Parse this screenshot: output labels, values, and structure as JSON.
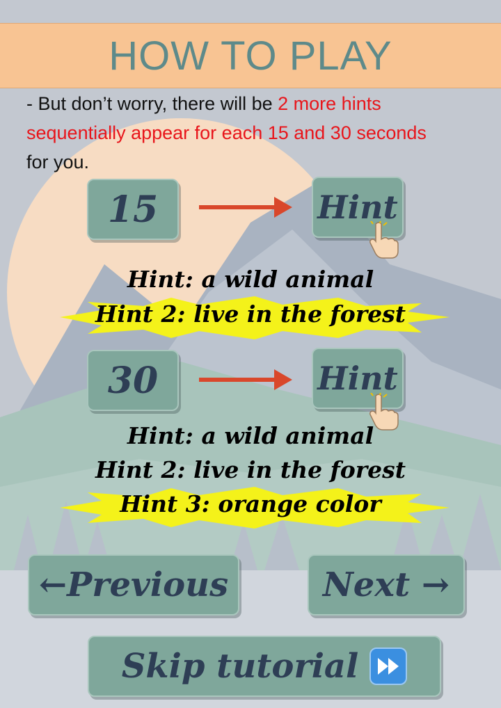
{
  "header": {
    "title": "HOW TO PLAY"
  },
  "intro": {
    "part1": "- But don’t worry, there will be ",
    "part2": "2 more hints sequentially appear for each 15 and 30 seconds",
    "part3": " for you."
  },
  "demo1": {
    "timer": "15",
    "hint_button": "Hint",
    "lines": [
      "Hint: a wild animal",
      "Hint 2: live in the forest"
    ]
  },
  "demo2": {
    "timer": "30",
    "hint_button": "Hint",
    "lines": [
      "Hint: a wild animal",
      "Hint 2: live in the forest",
      "Hint 3: orange color"
    ]
  },
  "nav": {
    "previous": "←Previous",
    "next": "Next →",
    "skip": "Skip tutorial"
  },
  "colors": {
    "header_bg": "#f8c493",
    "title_color": "#5e8a8a",
    "highlight_red": "#e8151b",
    "button_bg": "#7fa79b",
    "arrow": "#d9472b",
    "burst": "#f4f21a"
  },
  "icons": {
    "skip": "fast-forward-icon",
    "hand": "pointing-hand-icon",
    "arrow": "right-arrow-icon"
  }
}
